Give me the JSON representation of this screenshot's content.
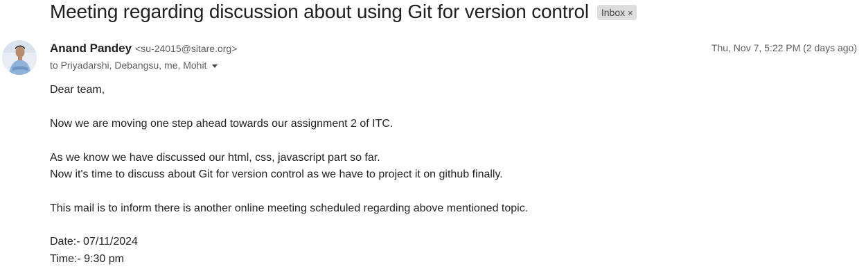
{
  "email": {
    "subject": "Meeting regarding discussion about using Git for version control",
    "label": "Inbox",
    "label_close": "×",
    "sender": {
      "name": "Anand Pandey",
      "email": "<su-24015@sitare.org>"
    },
    "timestamp": "Thu, Nov 7, 5:22 PM (2 days ago)",
    "recipients": "to Priyadarshi, Debangsu, me, Mohit",
    "body": {
      "greeting": "Dear team,",
      "line1": "Now we are moving one step ahead towards our assignment 2 of ITC.",
      "line2": "As we know we have discussed our html, css, javascript part so far.",
      "line3": "Now it's time to discuss about Git for version control as we have to project it on github finally.",
      "line4": "This mail is to inform there is another online meeting scheduled regarding above mentioned topic.",
      "date_line": "Date:- 07/11/2024",
      "time_line": "Time:- 9:30 pm"
    }
  }
}
